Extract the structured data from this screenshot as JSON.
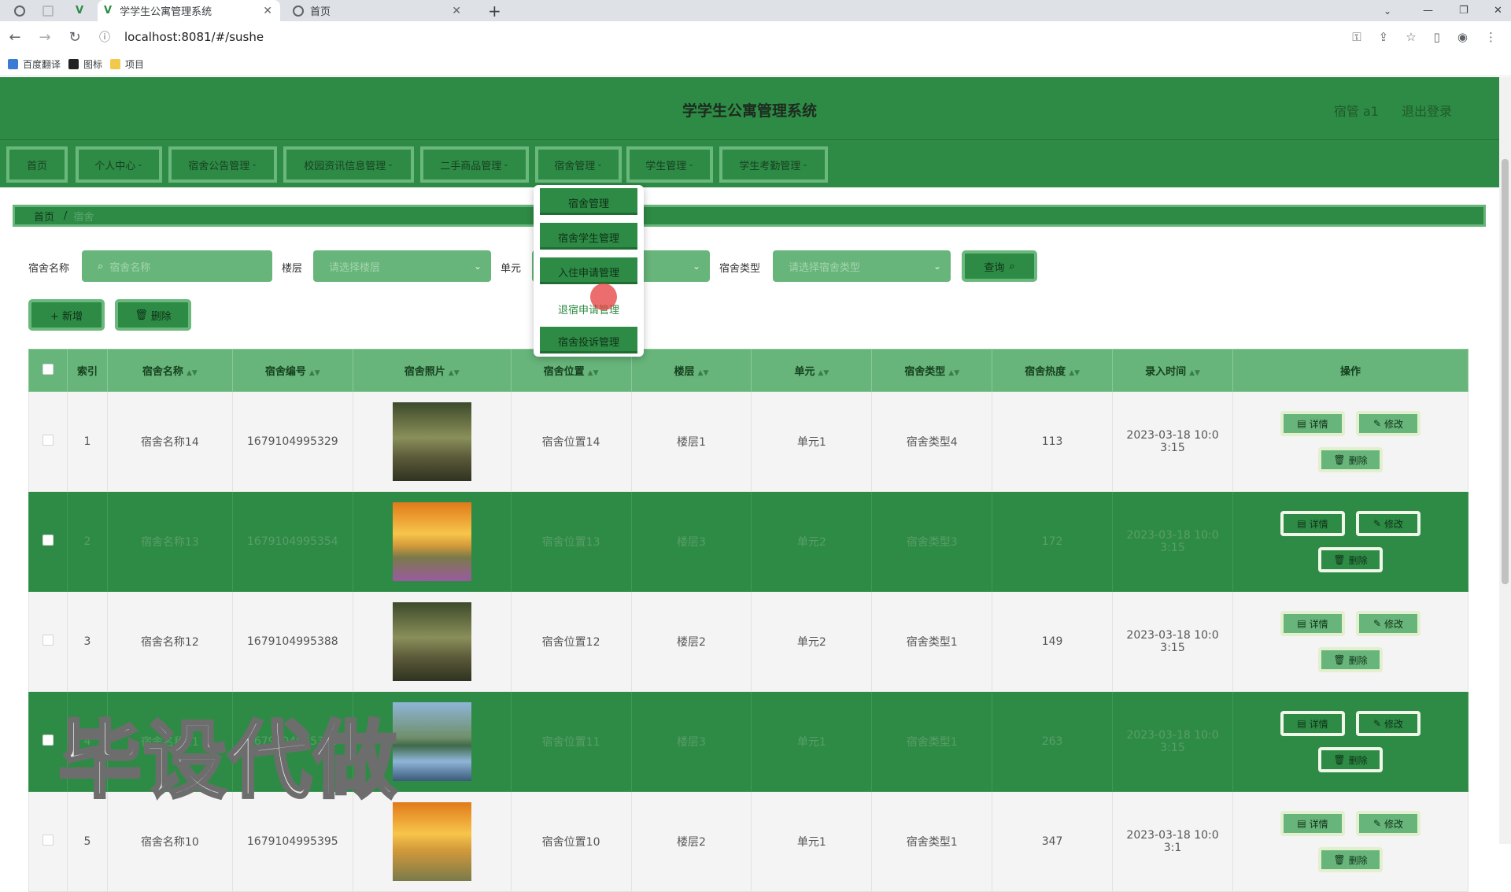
{
  "browser": {
    "tabs": [
      {
        "title": ""
      },
      {
        "title": ""
      },
      {
        "title": ""
      },
      {
        "title": "学学生公寓管理系统"
      },
      {
        "title": "首页"
      }
    ],
    "url": "localhost:8081/#/sushe",
    "bookmarks": [
      "百度翻译",
      "图标",
      "项目"
    ]
  },
  "header": {
    "title": "学学生公寓管理系统",
    "user": "宿管 a1",
    "logout": "退出登录"
  },
  "menu": [
    "首页",
    "个人中心",
    "宿舍公告管理",
    "校园资讯信息管理",
    "二手商品管理",
    "宿舍管理",
    "学生管理",
    "学生考勤管理"
  ],
  "dropdown": [
    "宿舍管理",
    "宿舍学生管理",
    "入住申请管理",
    "退宿申请管理",
    "宿舍投诉管理"
  ],
  "breadcrumb": {
    "home": "首页",
    "current": "宿舍"
  },
  "filters": {
    "name_label": "宿舍名称",
    "name_placeholder": "宿舍名称",
    "floor_label": "楼层",
    "floor_placeholder": "请选择楼层",
    "unit_label": "单元",
    "type_label": "宿舍类型",
    "type_placeholder": "请选择宿舍类型",
    "query": "查询"
  },
  "actions": {
    "add": "+ 新增",
    "delete": "删除"
  },
  "table": {
    "headers": [
      "索引",
      "宿舍名称",
      "宿舍编号",
      "宿舍照片",
      "宿舍位置",
      "楼层",
      "单元",
      "宿舍类型",
      "宿舍热度",
      "录入时间",
      "操作"
    ],
    "rows": [
      {
        "idx": "1",
        "name": "宿舍名称14",
        "code": "1679104995329",
        "pos": "宿舍位置14",
        "floor": "楼层1",
        "unit": "单元1",
        "type": "宿舍类型4",
        "heat": "113",
        "time": "2023-03-18 10:03:15"
      },
      {
        "idx": "2",
        "name": "宿舍名称13",
        "code": "1679104995354",
        "pos": "宿舍位置13",
        "floor": "楼层3",
        "unit": "单元2",
        "type": "宿舍类型3",
        "heat": "172",
        "time": "2023-03-18 10:03:15"
      },
      {
        "idx": "3",
        "name": "宿舍名称12",
        "code": "1679104995388",
        "pos": "宿舍位置12",
        "floor": "楼层2",
        "unit": "单元2",
        "type": "宿舍类型1",
        "heat": "149",
        "time": "2023-03-18 10:03:15"
      },
      {
        "idx": "4",
        "name": "宿舍名称11",
        "code": "1679104995390",
        "pos": "宿舍位置11",
        "floor": "楼层3",
        "unit": "单元1",
        "type": "宿舍类型1",
        "heat": "263",
        "time": "2023-03-18 10:03:15"
      },
      {
        "idx": "5",
        "name": "宿舍名称10",
        "code": "1679104995395",
        "pos": "宿舍位置10",
        "floor": "楼层2",
        "unit": "单元1",
        "type": "宿舍类型1",
        "heat": "347",
        "time": "2023-03-18 10:03:1"
      }
    ],
    "btn_detail": "详情",
    "btn_edit": "修改",
    "btn_delete": "删除"
  },
  "watermark": "毕设代做"
}
